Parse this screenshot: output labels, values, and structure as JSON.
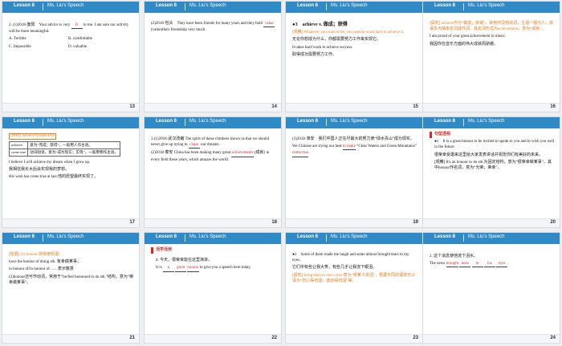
{
  "header": {
    "lesson": "Lesson 8",
    "title": "Ms. Liu's Speech"
  },
  "slides": [
    {
      "num": "13",
      "lines": [
        "2. (1)2018·衡阳　Your advice is very ",
        "D",
        " to me. I am sure our activity will be more meaningful."
      ],
      "opts": [
        "A. Terrible",
        "B. comfortable",
        "C. Impossible",
        "D. valuable"
      ]
    },
    {
      "num": "14",
      "l1": "(2)2018·包头　They have been friends for many years and they both ",
      "ans": "value",
      "l2": " (value)their friendship very much."
    },
    {
      "num": "15",
      "head": "●3　achieve v. 做成；获得",
      "l1": "[观察] Whatever you want to be, you need to work hard to achieve it.",
      "l2": "无论你想成为什么，你都需要努力工作来实现它。",
      "l3": "It takes hard work to achieve success.",
      "l4": "取得成功需要努力工作。"
    },
    {
      "num": "16",
      "l1": "[探究] achieve作为“做成；获得”，常用作及物动词，主语一般为人，宾语多为抽象名词或代词。其名词形式为achievement，意为“成就”。",
      "l2": "I am proud of your great achievement in music.",
      "l3": "我因你在音乐方面的伟大成就而骄傲。"
    },
    {
      "num": "17",
      "tag": "[辨析] achieve与come true",
      "r1a": "achieve",
      "r1b": "意为“完成；获得”，一般用人作主语。",
      "r2a": "come true",
      "r2b": "动词短语，意为“成为现实；实现”，一般用物作主语。",
      "l1": "I believe I will achieve my dream when I grow up.",
      "l2": "我相信我长大后会实现我的梦想。",
      "l3": "His wish has come true at last.他的愿望最终实现了。"
    },
    {
      "num": "18",
      "l1": "3.(1)2018·武汉改编 The spirit of these climbers shows us that we should never give up trying to ",
      "a1": "chase",
      "l2": " our dreams.",
      "l3": "(2)2018·泰安 China has been making many great ",
      "a2": "achievements",
      "l4": " (成就) in every field these years, which amazes the world."
    },
    {
      "num": "19",
      "l1": "(3)2018·淮安　我们中国人正在尽最大的努力使“绿水青山”成为现实。",
      "l2": "We Chinese are trying our best ",
      "a1": "to make",
      "l3": " “Clear Waters and Green Mountains” ",
      "a2": "come true",
      "l4": "."
    },
    {
      "num": "20",
      "tag": "句型透视",
      "l1": "●1　It is a great honour to be invited to speak to you and to wish you well in the future.",
      "l2": "很荣幸受邀来这里给大家发表讲话并祝愿你们有美好的未来。",
      "l3": "[观察] It's an honour to do sth.为固定结构，意为“很荣幸做某事”。其中honour作名词，意为“光荣；荣幸”。"
    },
    {
      "num": "21",
      "l1": "[拓展] (1) honour 的常用短语：",
      "l2": "have the honour of doing sth. 有幸做某事；",
      "l3": "in honour of/in honour of……表示敬意",
      "l4": "(2)honour还可作动词，常用于“be/feel honoured to do sth.”结构，意为“荣幸做某事”。"
    },
    {
      "num": "22",
      "tag": "活学活用",
      "l1": "4. 今天，很荣幸能在这里演讲。",
      "l2": "It is ",
      "b1": "a",
      "b2": "great",
      "b3": "honour",
      "l3": " to give you a speech here today."
    },
    {
      "num": "23",
      "l1": "●2　Some of them made me laugh and some almost brought tears to my eyes.",
      "l2": "它们中有些让我大笑，有些几乎让我流下眼泪。",
      "l3": "[探究] bring tears to one's eyes 意为“使某人流泪”，根据不同的语境可以译为“伤心得流泪、激动得流泪”等。"
    },
    {
      "num": "24",
      "l1": "2. 这个消息使他流下泪水。",
      "l2": "The news ",
      "b1": "brought",
      "b2": "tears",
      "b3": "to",
      "b4": "his",
      "b5": "eyes",
      "l3": "."
    }
  ]
}
